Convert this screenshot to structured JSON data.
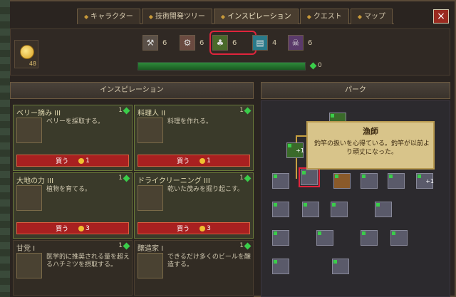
{
  "tabs": [
    {
      "label": "キャラクター"
    },
    {
      "label": "技術開発ツリー"
    },
    {
      "label": "インスピレーション"
    },
    {
      "label": "クエスト"
    },
    {
      "label": "マップ"
    }
  ],
  "close_label": "×",
  "currency": {
    "amount": "48"
  },
  "categories": [
    {
      "icon": "hammer-icon",
      "count": "6"
    },
    {
      "icon": "gear-icon",
      "count": "6"
    },
    {
      "icon": "wheat-icon",
      "count": "6"
    },
    {
      "icon": "book-icon",
      "count": "4"
    },
    {
      "icon": "skull-icon",
      "count": "6"
    }
  ],
  "progress": {
    "value": "0",
    "fraction": 1.0
  },
  "panels": {
    "left_title": "インスピレーション",
    "right_title": "パーク"
  },
  "cards": [
    {
      "name": "ベリー摘み III",
      "level": "1",
      "desc": "ベリーを採取する。",
      "buy": "買う",
      "cost": "1"
    },
    {
      "name": "料理人 II",
      "level": "1",
      "desc": "料理を作れる。",
      "buy": "買う",
      "cost": "1"
    },
    {
      "name": "大地の力 III",
      "level": "1",
      "desc": "植物を育てる。",
      "buy": "買う",
      "cost": "3"
    },
    {
      "name": "ドライクリーニング III",
      "level": "1",
      "desc": "乾いた茂みを掘り起こす。",
      "buy": "買う",
      "cost": "3"
    },
    {
      "name": "甘党 I",
      "level": "1",
      "desc": "医学的に推奨される量を超えるハチミツを摂取する。"
    },
    {
      "name": "醸造家 I",
      "level": "1",
      "desc": "できるだけ多くのビールを醸造する。"
    }
  ],
  "tooltip": {
    "title": "漁師",
    "desc": "釣竿の扱いを心得ている。釣竿が以前より頑丈になった。"
  },
  "perk_badges": {
    "a": "+1",
    "b": "+1"
  },
  "colors": {
    "accent_red": "#e0243c",
    "progress_green": "#2e8a3a",
    "buy_red": "#a82020"
  }
}
